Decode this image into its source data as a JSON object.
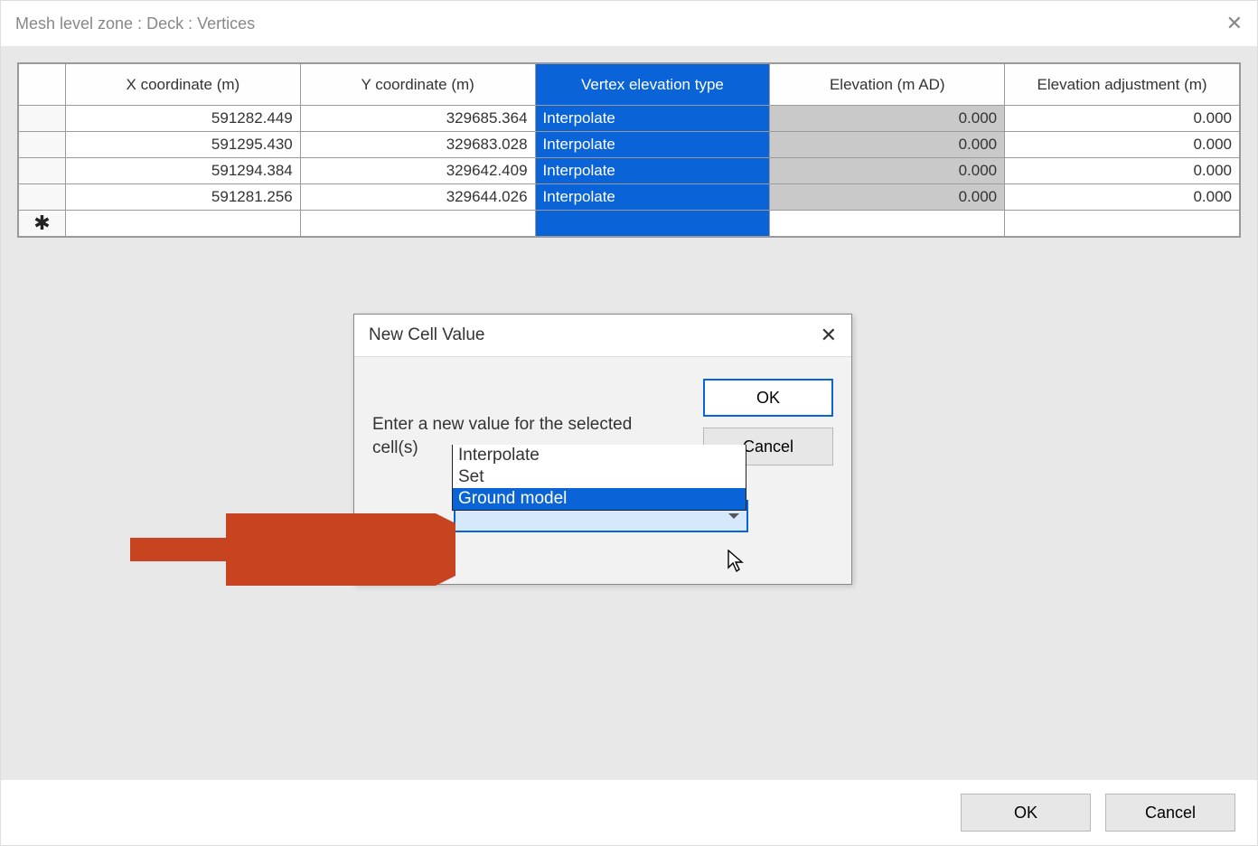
{
  "window": {
    "title": "Mesh level zone : Deck : Vertices",
    "close_glyph": "✕"
  },
  "table": {
    "headers": {
      "x": "X coordinate (m)",
      "y": "Y coordinate (m)",
      "type": "Vertex elevation type",
      "elev": "Elevation (m AD)",
      "adj": "Elevation adjustment (m)"
    },
    "rows": [
      {
        "x": "591282.449",
        "y": "329685.364",
        "type": "Interpolate",
        "elev": "0.000",
        "adj": "0.000"
      },
      {
        "x": "591295.430",
        "y": "329683.028",
        "type": "Interpolate",
        "elev": "0.000",
        "adj": "0.000"
      },
      {
        "x": "591294.384",
        "y": "329642.409",
        "type": "Interpolate",
        "elev": "0.000",
        "adj": "0.000"
      },
      {
        "x": "591281.256",
        "y": "329644.026",
        "type": "Interpolate",
        "elev": "0.000",
        "adj": "0.000"
      }
    ],
    "newrow_glyph": "✱"
  },
  "modal": {
    "title": "New Cell Value",
    "close_glyph": "✕",
    "prompt": "Enter a new value for the selected cell(s)",
    "ok": "OK",
    "cancel": "Cancel",
    "options": [
      "Interpolate",
      "Set",
      "Ground model"
    ],
    "highlighted_index": 2
  },
  "footer": {
    "ok": "OK",
    "cancel": "Cancel"
  }
}
